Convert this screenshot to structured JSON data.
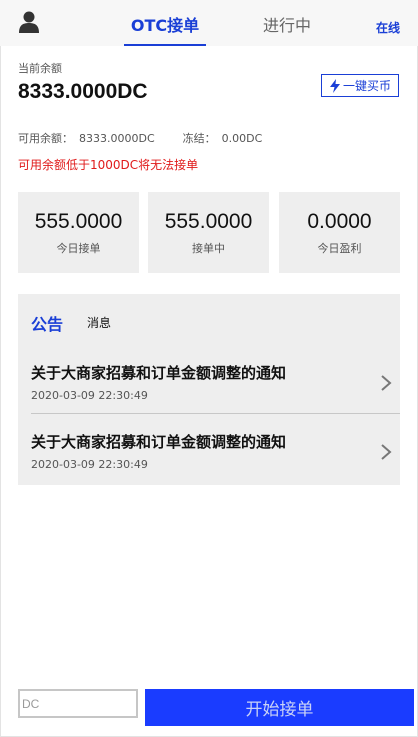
{
  "header": {
    "avatar_icon": "user-icon",
    "tabs": [
      {
        "label": "OTC接单",
        "active": true
      },
      {
        "label": "进行中",
        "active": false
      }
    ],
    "status": "在线"
  },
  "balance": {
    "label": "当前余额",
    "value": "8333.0000DC",
    "buy_button": {
      "icon": "lightning-icon",
      "label": "一键买币"
    }
  },
  "account": {
    "available_label": "可用余额：",
    "available_value": "8333.0000DC",
    "frozen_label": "冻结：",
    "frozen_value": "0.00DC",
    "warning": "可用余额低于1000DC将无法接单"
  },
  "stats": [
    {
      "value": "555.0000",
      "label": "今日接单"
    },
    {
      "value": "555.0000",
      "label": "接单中"
    },
    {
      "value": "0.0000",
      "label": "今日盈利"
    }
  ],
  "notices": {
    "tab_announcement": "公告",
    "tab_messages": "消息",
    "items": [
      {
        "title": "关于大商家招募和订单金额调整的通知",
        "date": "2020-03-09 22:30:49"
      },
      {
        "title": "关于大商家招募和订单金额调整的通知",
        "date": "2020-03-09 22:30:49"
      }
    ]
  },
  "bottom": {
    "input_placeholder": "DC",
    "start_button": "开始接单"
  },
  "colors": {
    "accent": "#1a3fd6",
    "button": "#1a3cff",
    "warning": "#e01a1a",
    "panel": "#eeeeee"
  }
}
